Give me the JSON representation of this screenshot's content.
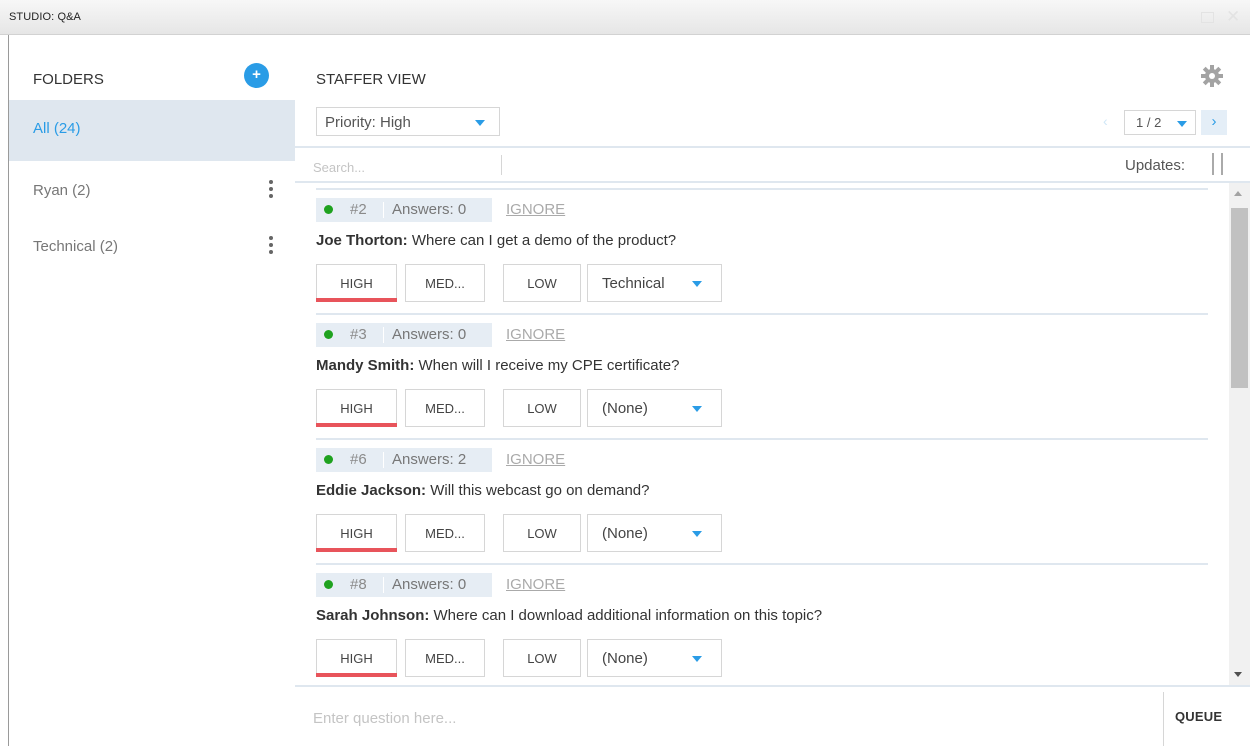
{
  "window": {
    "title": "STUDIO: Q&A"
  },
  "sidebar": {
    "heading": "FOLDERS",
    "add_label": "+",
    "folders": [
      {
        "label": "All (24)",
        "active": true
      },
      {
        "label": "Ryan (2)",
        "active": false
      },
      {
        "label": "Technical (2)",
        "active": false
      }
    ]
  },
  "main": {
    "title": "STAFFER VIEW",
    "priority_filter": "Priority: High",
    "pager": {
      "prev": "‹",
      "value": "1 / 2",
      "next": "›"
    },
    "search_placeholder": "Search...",
    "updates_label": "Updates:",
    "questions": [
      {
        "id": "#2",
        "answers": "Answers: 0",
        "ignore": "IGNORE",
        "author": "Joe Thorton:",
        "text": " Where can I get a demo of the product?",
        "high": "HIGH",
        "med": "MED...",
        "low": "LOW",
        "folder": "Technical"
      },
      {
        "id": "#3",
        "answers": "Answers: 0",
        "ignore": "IGNORE",
        "author": "Mandy Smith:",
        "text": " When will I receive my CPE certificate?",
        "high": "HIGH",
        "med": "MED...",
        "low": "LOW",
        "folder": "(None)"
      },
      {
        "id": "#6",
        "answers": "Answers: 2",
        "ignore": "IGNORE",
        "author": "Eddie Jackson:",
        "text": " Will this webcast go on demand?",
        "high": "HIGH",
        "med": "MED...",
        "low": "LOW",
        "folder": "(None)"
      },
      {
        "id": "#8",
        "answers": "Answers: 0",
        "ignore": "IGNORE",
        "author": "Sarah Johnson:",
        "text": " Where can I download additional information on this topic?",
        "high": "HIGH",
        "med": "MED...",
        "low": "LOW",
        "folder": "(None)"
      }
    ],
    "question_placeholder": "Enter question here...",
    "queue_label": "QUEUE"
  },
  "colors": {
    "accent": "#2a9ce6",
    "high_bar": "#e8545b",
    "online_dot": "#1fa21f"
  },
  "icons": [
    "add-icon",
    "kebab-icon",
    "gear-icon",
    "caret-down-icon",
    "pause-icon",
    "chevron-left-icon",
    "chevron-right-icon"
  ]
}
